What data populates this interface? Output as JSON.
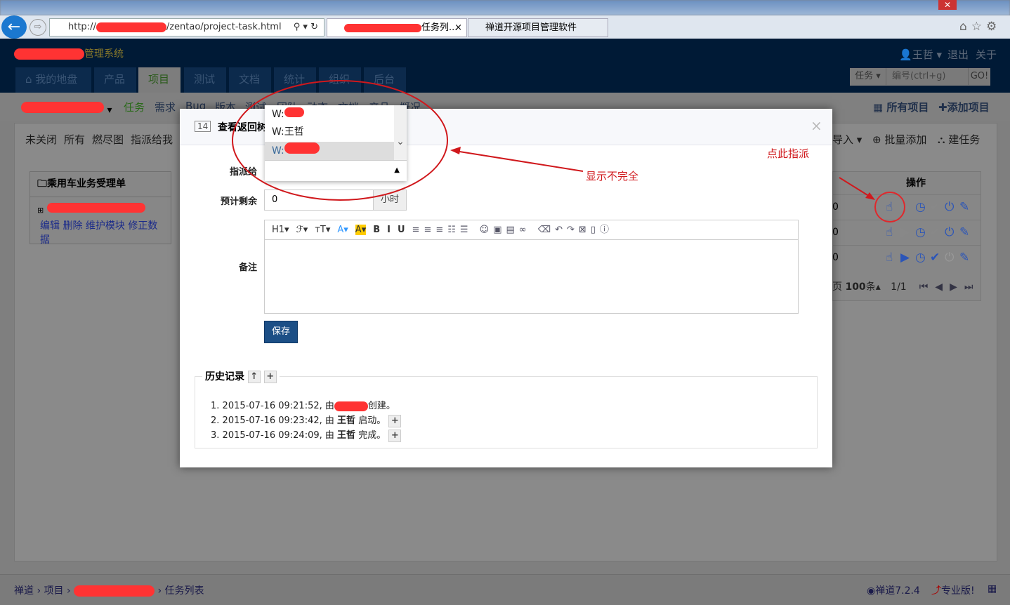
{
  "browser": {
    "url_prefix": "http://",
    "url_suffix": "/zentao/project-task.html",
    "tab1_suffix": "任务列...",
    "tab2": "禅道开源项目管理软件"
  },
  "header": {
    "system_suffix": "管理系统",
    "user": "王哲",
    "logout": "退出",
    "about": "关于",
    "search_type": "任务",
    "search_placeholder": "编号(ctrl+g)",
    "go": "GO!"
  },
  "nav": [
    "我的地盘",
    "产品",
    "项目",
    "测试",
    "文档",
    "统计",
    "组织",
    "后台"
  ],
  "subnav": [
    "任务",
    "需求",
    "Bug",
    "版本",
    "测试",
    "团队",
    "动态",
    "文档",
    "产品",
    "概况"
  ],
  "subnav_right": {
    "all_projects": "所有项目",
    "add_project": "添加项目"
  },
  "toolbar_left": [
    "未关闭",
    "所有",
    "燃尽图",
    "指派给我"
  ],
  "toolbar_right": {
    "import": "导入",
    "batch_add": "批量添加",
    "build_task": "建任务"
  },
  "tree": {
    "title": "乘用车业务受理单",
    "actions": "编辑 删除 维护模块 修正数据"
  },
  "grid": {
    "header": "操作",
    "row_values": [
      "0",
      "0",
      "0"
    ],
    "pager": {
      "per_page_prefix": "页",
      "per_page": "100",
      "per_page_unit": "条",
      "page": "1/1"
    }
  },
  "modal": {
    "id": "14",
    "title": "查看返回树",
    "close": "×",
    "assign_label": "指派给",
    "remain_label": "预计剩余",
    "remain_value": "0",
    "remain_unit": "小时",
    "comment_label": "备注",
    "save": "保存",
    "dropdown_items": [
      "W:",
      "W:王哲",
      "W:"
    ],
    "toolbar": [
      "H1▾",
      "ℱ▾",
      "тT▾",
      "A▾",
      "A▾",
      "B",
      "I",
      "U"
    ],
    "history": {
      "title": "历史记录",
      "entries": [
        {
          "n": "1.",
          "time": "2015-07-16 09:21:52, 由",
          "user": "",
          "action": "创建。"
        },
        {
          "n": "2.",
          "time": "2015-07-16 09:23:42, 由",
          "user": "王哲",
          "action": "启动。"
        },
        {
          "n": "3.",
          "time": "2015-07-16 09:24:09, 由",
          "user": "王哲",
          "action": "完成。"
        }
      ]
    }
  },
  "annotations": {
    "incomplete": "显示不完全",
    "click_assign": "点此指派"
  },
  "footer": {
    "crumbs": [
      "禅道",
      "项目",
      "任务列表"
    ],
    "version": "禅道7.2.4",
    "pro": "专业版!"
  },
  "colors": {
    "annotation": "#d0181c",
    "header": "#001a36",
    "save": "#1c4f86"
  }
}
